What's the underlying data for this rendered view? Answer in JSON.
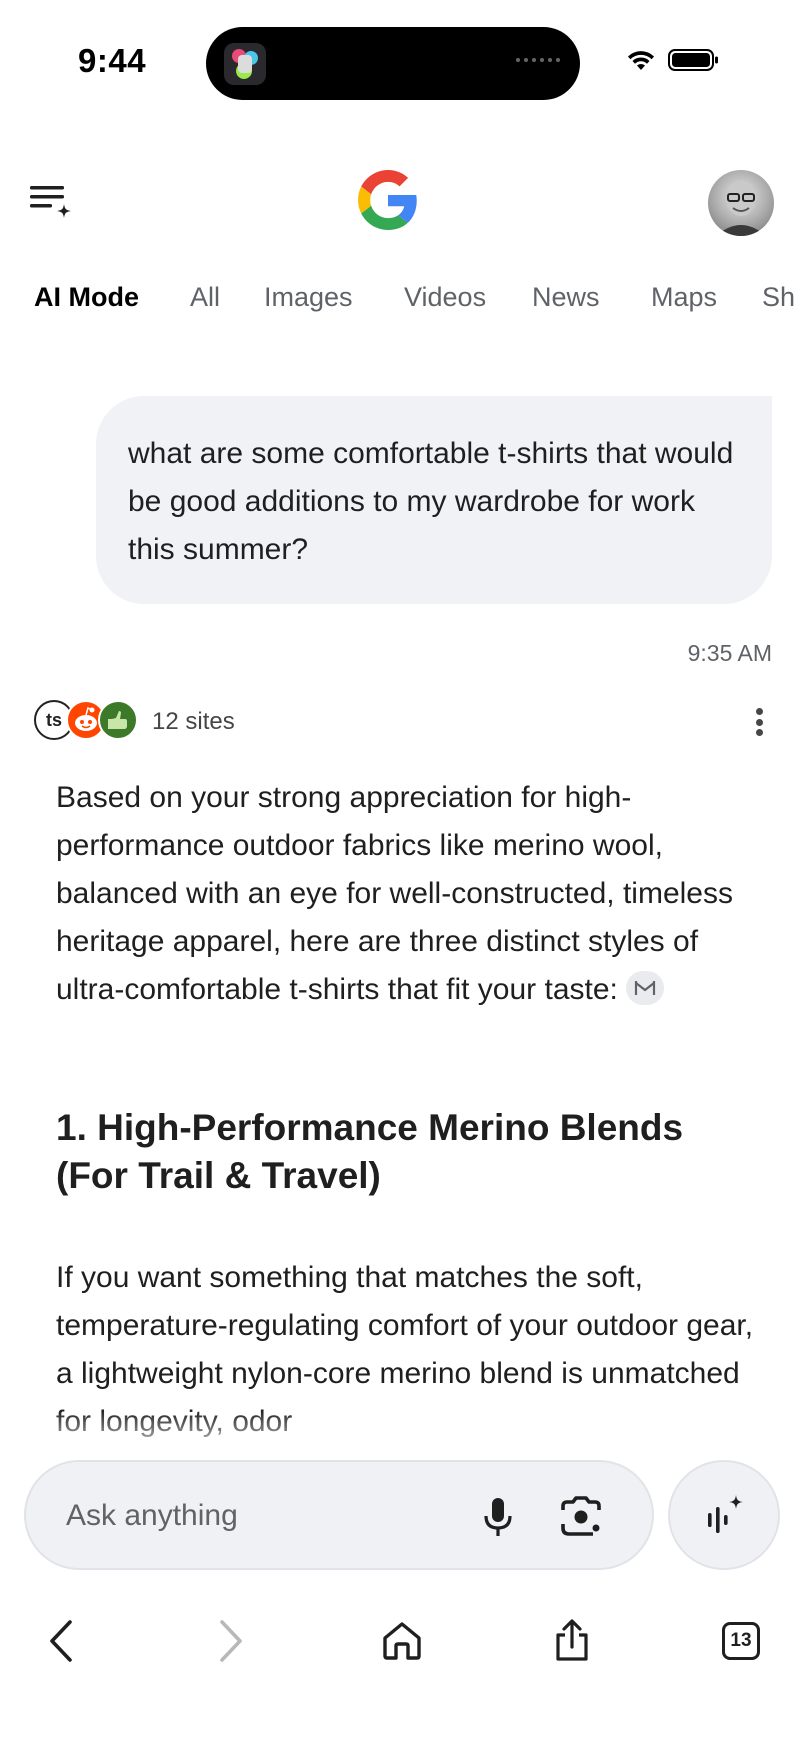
{
  "status_bar": {
    "time": "9:44"
  },
  "header": {
    "logo": "google-g-logo",
    "menu_icon": "ai-history-menu-icon"
  },
  "tabs": [
    {
      "label": "AI Mode",
      "active": true
    },
    {
      "label": "All",
      "active": false
    },
    {
      "label": "Images",
      "active": false
    },
    {
      "label": "Videos",
      "active": false
    },
    {
      "label": "News",
      "active": false
    },
    {
      "label": "Maps",
      "active": false
    },
    {
      "label": "Sh",
      "active": false
    }
  ],
  "conversation": {
    "user_query": "what are some comfortable t-shirts that would be good additions to my wardrobe for work this summer?",
    "timestamp": "9:35 AM"
  },
  "sources": {
    "count_label": "12 sites",
    "icons": [
      "ts-site-icon",
      "reddit-icon",
      "thumbs-up-site-icon"
    ],
    "ts_label": "ts"
  },
  "answer": {
    "intro": "Based on your strong appreciation for high-performance outdoor fabrics like merino wool, balanced with an eye for well-constructed, timeless heritage apparel, here are three distinct styles of ultra-comfortable t-shirts that fit your taste:",
    "section_1_heading": "1. High-Performance Merino Blends (For Trail & Travel)",
    "section_1_body": "If you want something that matches the soft, temperature-regulating comfort of your outdoor gear, a lightweight nylon-core merino blend is unmatched for longevity, odor"
  },
  "ask_bar": {
    "placeholder": "Ask anything"
  },
  "browser_bar": {
    "tab_count": "13"
  },
  "colors": {
    "bubble_bg": "#f0f2f6",
    "ask_bar_bg": "#eff1f5",
    "muted_text": "#5f6368",
    "google_blue": "#4285F4",
    "google_red": "#EA4335",
    "google_yellow": "#FBBC05",
    "google_green": "#34A853"
  }
}
